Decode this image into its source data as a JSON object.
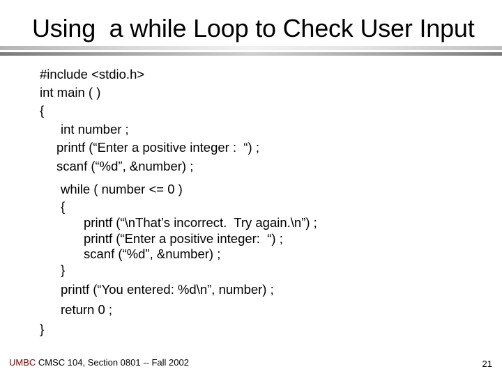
{
  "slide": {
    "title": "Using  a while Loop to Check User Input",
    "code_lines": [
      "#include <stdio.h>",
      "int main ( )",
      "{",
      "int number ;",
      "printf (“Enter a positive integer :  “) ;",
      "scanf (“%d”, &number) ;",
      "while ( number <= 0 )",
      "{",
      "printf (“\\nThat’s incorrect.  Try again.\\n”) ;",
      "printf (“Enter a positive integer:  “) ;",
      "scanf (“%d”, &number) ;",
      "}",
      "printf (“You entered: %d\\n”, number) ;",
      "return 0 ;",
      "}"
    ]
  },
  "footer": {
    "brand": "UMBC",
    "course": " CMSC 104, Section 0801 -- Fall 2002",
    "page_number": "21"
  },
  "colors": {
    "brand": "#800000",
    "text": "#000000",
    "background": "#ffffff"
  }
}
